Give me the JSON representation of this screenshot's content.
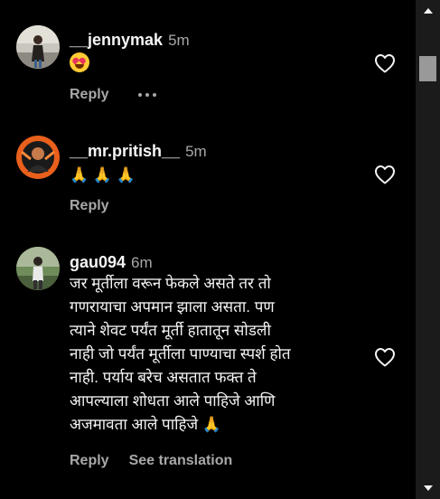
{
  "comments": [
    {
      "username": "__jennymak",
      "time": "5m",
      "body_emoji": "smiling-face-with-heart-eyes",
      "reply_label": "Reply"
    },
    {
      "username": "__mr.pritish__",
      "time": "5m",
      "body_text": "🙏 🙏 🙏",
      "reply_label": "Reply"
    },
    {
      "username": "gau094",
      "time": "6m",
      "body_lines": [
        "जर मूर्तीला वरून फेकले असते तर तो",
        "गणरायाचा अपमान झाला असता. पण",
        "त्याने शेवट पर्यंत मूर्ती हातातून सोडली",
        "नाही जो पर्यंत मूर्तीला पाण्याचा स्पर्श होत",
        "नाही. पर्याय बरेच असतात फक्त ते",
        "आपल्याला शोधता आले पाहिजे आणि",
        "अजमावता आले पाहिजे 🙏"
      ],
      "reply_label": "Reply",
      "translate_label": "See translation"
    }
  ],
  "colors": {
    "background": "#000000",
    "text": "#f5f5f5",
    "muted": "#a8a8a8"
  },
  "icons": {
    "like": "heart-outline-icon",
    "more": "more-dots-icon",
    "scroll_up": "scroll-up-arrow-icon",
    "scroll_down": "scroll-down-arrow-icon"
  }
}
